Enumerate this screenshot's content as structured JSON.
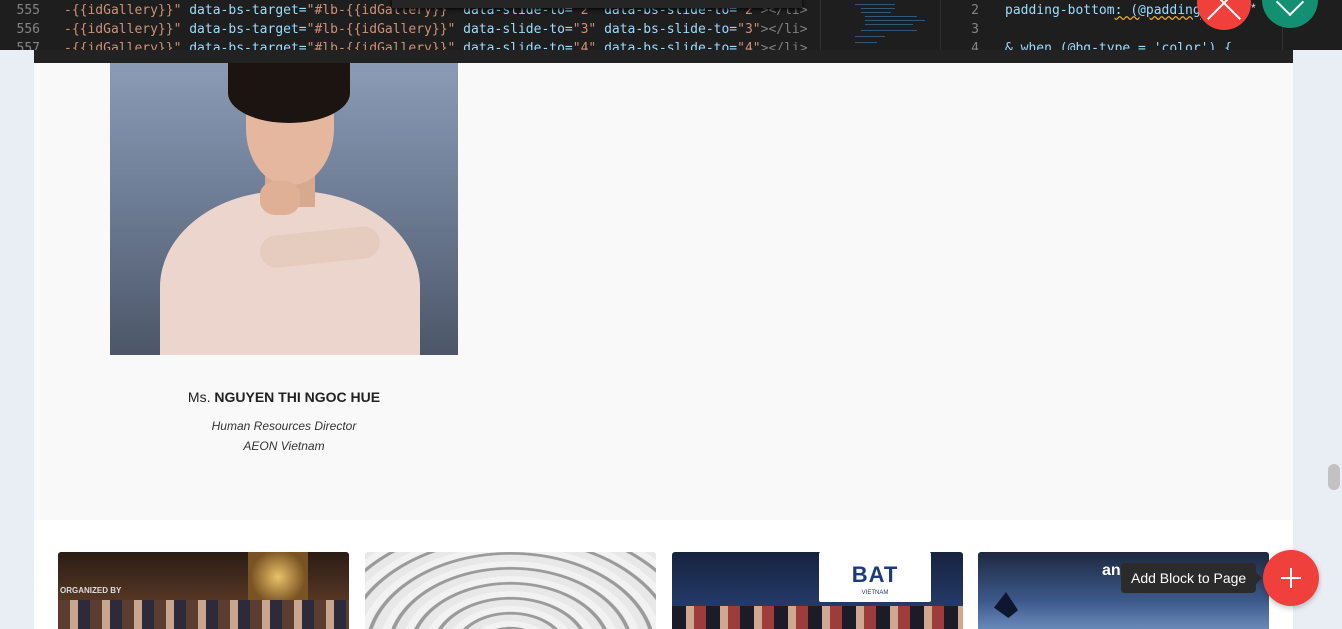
{
  "editor": {
    "left_lines": [
      {
        "num": "555",
        "pre": "-{{idGallery}}\"",
        "attr1": " data-bs-target=",
        "val1": "\"#lb-{{idGallery}}\"",
        "attr2": " data-slide-to=",
        "val2": "\"2\"",
        "attr3": " data-bs-slide-to=",
        "val3": "\"2\"",
        "tail": "></li>"
      },
      {
        "num": "556",
        "pre": "-{{idGallery}}\"",
        "attr1": " data-bs-target=",
        "val1": "\"#lb-{{idGallery}}\"",
        "attr2": " data-slide-to=",
        "val2": "\"3\"",
        "attr3": " data-bs-slide-to=",
        "val3": "\"3\"",
        "tail": "></li>"
      },
      {
        "num": "557",
        "pre": "-{{idGallery}}\"",
        "attr1": " data-bs-target=",
        "val1": "\"#lb-{{idGallery}}\"",
        "attr2": " data-slide-to=",
        "val2": "\"4\"",
        "attr3": " data-bs-slide-to=",
        "val3": "\"4\"",
        "tail": "></li>"
      }
    ],
    "right_lines": [
      {
        "num": "2",
        "text_a": "padding-bottom",
        "text_b": ": (@padding"
      },
      {
        "num": "3",
        "text_a": "",
        "text_b": ""
      },
      {
        "num": "4",
        "text_a": "& when (@bg",
        "text_b": "-type = 'color') {"
      }
    ],
    "colors": {
      "close": "#f0403c",
      "confirm": "#138f72"
    }
  },
  "profile": {
    "prefix": "Ms.",
    "name": "NGUYEN THI NGOC HUE",
    "role": "Human Resources Director",
    "company": "AEON Vietnam"
  },
  "gallery": {
    "card1_text": "ORGANIZED BY",
    "card3_logo": "BAT",
    "card3_sub": "VIETNAM",
    "card4_text": "an"
  },
  "add_block": {
    "tooltip": "Add Block to Page",
    "color": "#f0403c"
  }
}
